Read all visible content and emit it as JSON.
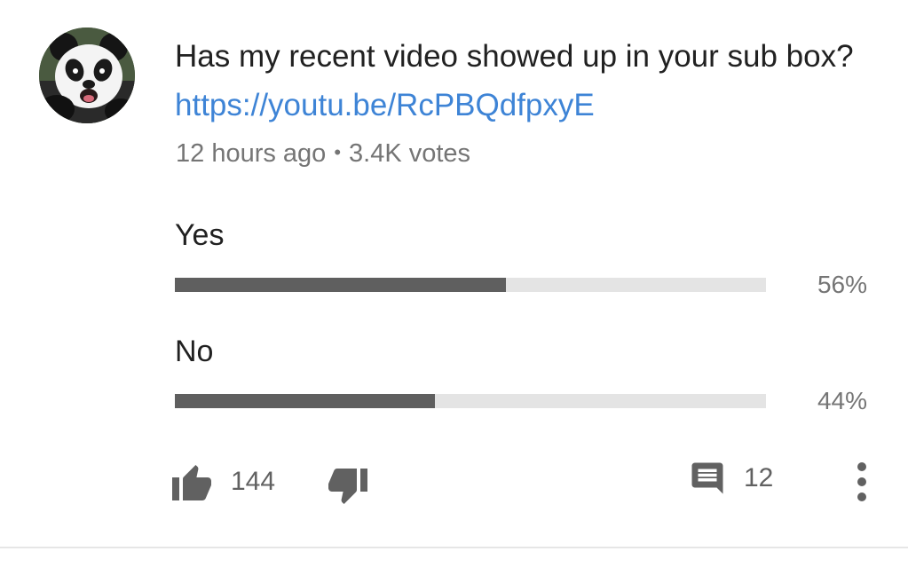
{
  "post": {
    "text": "Has my recent video showed up in your sub box?",
    "link": "https://youtu.be/RcPBQdfpxyE",
    "time_ago": "12 hours ago",
    "separator": "•",
    "votes": "3.4K votes"
  },
  "poll": {
    "options": [
      {
        "label": "Yes",
        "percent_text": "56%",
        "fraction": 0.56
      },
      {
        "label": "No",
        "percent_text": "44%",
        "fraction": 0.44
      }
    ],
    "bar_fill_color": "#5f5f5f",
    "bar_track_color": "#e4e4e4"
  },
  "actions": {
    "like_count": "144",
    "comment_count": "12",
    "like_icon": "thumbs-up-icon",
    "dislike_icon": "thumbs-down-icon",
    "comment_icon": "comment-icon",
    "menu_icon": "more-vert-icon"
  },
  "colors": {
    "link": "#3e84d6",
    "text": "#212121",
    "secondary_text": "#757575"
  }
}
